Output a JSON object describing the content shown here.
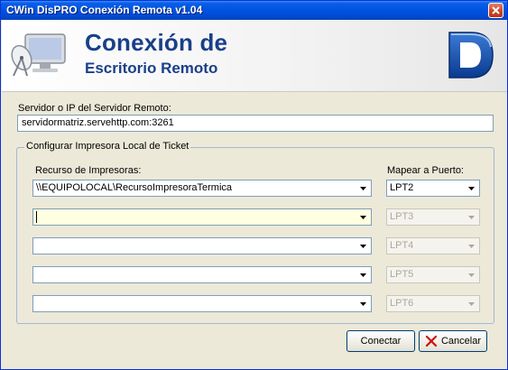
{
  "window": {
    "title": "CWin DisPRO Conexión Remota v1.04"
  },
  "header": {
    "title_line1": "Conexión de",
    "title_line2": "Escritorio Remoto",
    "brand_letter": "D",
    "logo_icon": "monitor-satellite-icon"
  },
  "server": {
    "label": "Servidor o IP del Servidor Remoto:",
    "value": "servidormatriz.servehttp.com:3261"
  },
  "printer_group": {
    "legend": "Configurar Impresora Local de Ticket",
    "resource_header": "Recurso de Impresoras:",
    "port_header": "Mapear a Puerto:",
    "rows": [
      {
        "resource": "\\\\EQUIPOLOCAL\\RecursoImpresoraTermica",
        "port": "LPT2"
      },
      {
        "resource": "",
        "port": "LPT3"
      },
      {
        "resource": "",
        "port": "LPT4"
      },
      {
        "resource": "",
        "port": "LPT5"
      },
      {
        "resource": "",
        "port": "LPT6"
      }
    ]
  },
  "buttons": {
    "connect": "Conectar",
    "cancel": "Cancelar"
  },
  "colors": {
    "title_bar": "#0053e0",
    "header_text": "#1a3f8a",
    "focus_field": "#ffffe1",
    "cancel_x": "#cc1111"
  }
}
